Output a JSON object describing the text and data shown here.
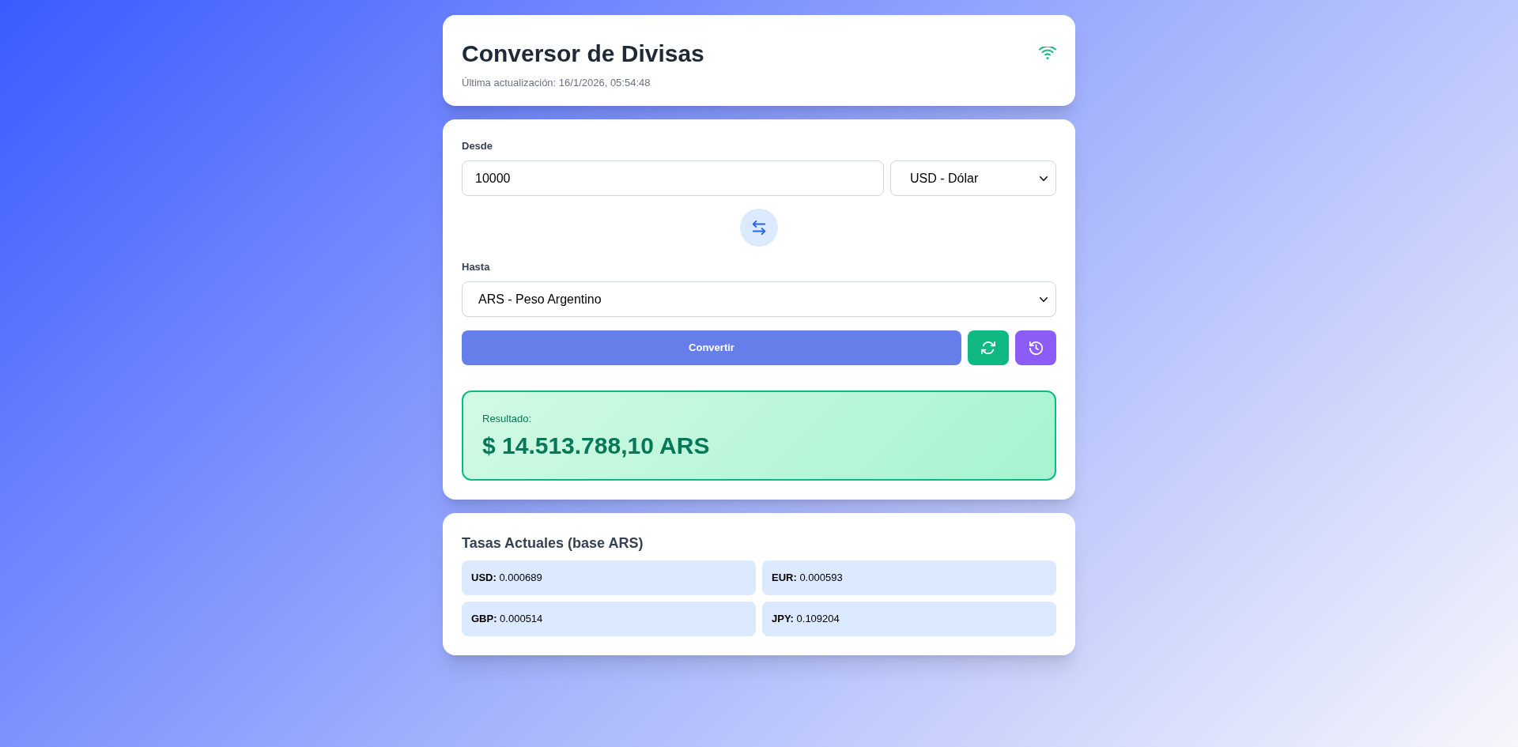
{
  "header": {
    "title": "Conversor de Divisas",
    "last_updated": "Última actualización: 16/1/2026, 05:54:48",
    "online": true
  },
  "converter": {
    "from_label": "Desde",
    "amount": "10000",
    "from_currency": "USD - Dólar",
    "to_label": "Hasta",
    "to_currency": "ARS - Peso Argentino",
    "convert_button": "Convertir",
    "result": {
      "label": "Resultado:",
      "value": "$ 14.513.788,10 ARS"
    }
  },
  "rates": {
    "title": "Tasas Actuales (base ARS)",
    "items": [
      {
        "text": "**USD:** 0.000689"
      },
      {
        "text": "**EUR:** 0.000593"
      },
      {
        "text": "**GBP:** 0.000514"
      },
      {
        "text": "**JPY:** 0.109204"
      }
    ]
  }
}
